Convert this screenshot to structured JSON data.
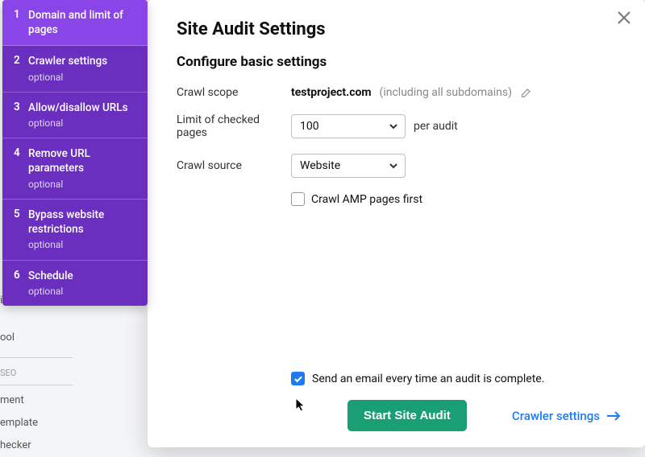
{
  "bg_stubs": [
    "ics",
    "ool",
    "SEO",
    "ment",
    "emplate",
    "hecker"
  ],
  "sidebar": {
    "items": [
      {
        "num": "1",
        "label": "Domain and limit of pages",
        "optional": ""
      },
      {
        "num": "2",
        "label": "Crawler settings",
        "optional": "optional"
      },
      {
        "num": "3",
        "label": "Allow/disallow URLs",
        "optional": "optional"
      },
      {
        "num": "4",
        "label": "Remove URL parameters",
        "optional": "optional"
      },
      {
        "num": "5",
        "label": "Bypass website restrictions",
        "optional": "optional"
      },
      {
        "num": "6",
        "label": "Schedule",
        "optional": "optional"
      }
    ]
  },
  "header": {
    "title": "Site Audit Settings",
    "subtitle": "Configure basic settings"
  },
  "form": {
    "scope_label": "Crawl scope",
    "scope_domain": "testproject.com",
    "scope_note": "(including all subdomains)",
    "limit_label": "Limit of checked pages",
    "limit_value": "100",
    "limit_after": "per audit",
    "source_label": "Crawl source",
    "source_value": "Website",
    "amp_label": "Crawl AMP pages first"
  },
  "footer": {
    "email_label": "Send an email every time an audit is complete.",
    "start_label": "Start Site Audit",
    "next_label": "Crawler settings"
  }
}
